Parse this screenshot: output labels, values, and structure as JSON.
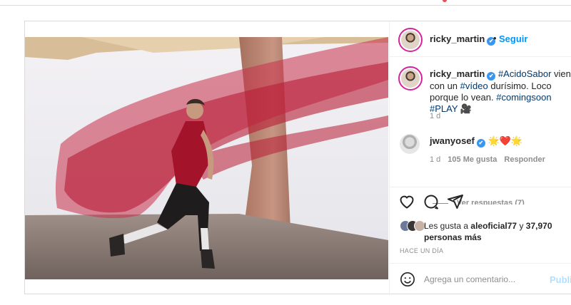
{
  "post": {
    "header": {
      "username": "ricky_martin",
      "verified": "✔",
      "separator": "•",
      "follow_label": "Seguir",
      "more_label": "⋯"
    },
    "caption": {
      "username": "ricky_martin",
      "verified": "✔",
      "parts": [
        {
          "text": "#AcidoSabor",
          "tag": true
        },
        {
          "text": " viene con un ",
          "tag": false
        },
        {
          "text": "#vídeo",
          "tag": true
        },
        {
          "text": " durísimo. Loco porque lo vean. ",
          "tag": false
        },
        {
          "text": "#comingsoon",
          "tag": true
        },
        {
          "text": " ",
          "tag": false
        },
        {
          "text": "#PLAY",
          "tag": true
        },
        {
          "text": " 🎥",
          "tag": false
        }
      ],
      "time": "1 d"
    },
    "comments": [
      {
        "username": "jwanyosef",
        "verified": "✔",
        "text": "🌟❤️🌟",
        "time": "1 d",
        "likes": "105 Me gusta",
        "reply_label": "Responder",
        "view_replies": "Ver respuestas (7)"
      }
    ],
    "likes": {
      "prefix": "Les gusta a",
      "user": "aleoficial77",
      "connector": "y",
      "others": "37,970 personas más"
    },
    "timestamp": "HACE UN DÍA",
    "comment_input": {
      "placeholder": "Agrega un comentario...",
      "publish_label": "Publicar"
    },
    "icons": [
      "heart-icon",
      "comment-icon",
      "share-icon",
      "bookmark-icon",
      "emoji-icon",
      "more-icon",
      "verified-icon"
    ],
    "colors": {
      "link": "#0095f6",
      "hashtag": "#00376b",
      "muted": "#8e8e8e",
      "publish_disabled": "#b2dffc",
      "verified": "#3897f0"
    }
  }
}
